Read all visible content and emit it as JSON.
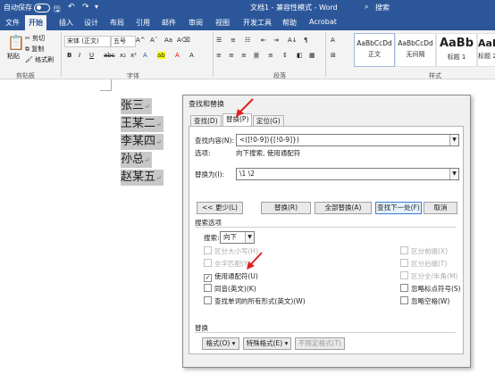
{
  "titlebar": {
    "autosave": "自动保存",
    "doc_title": "文档1 - 兼容性模式 - Word",
    "search": "搜索"
  },
  "menu": {
    "tabs": [
      "文件",
      "开始",
      "插入",
      "设计",
      "布局",
      "引用",
      "邮件",
      "审阅",
      "视图",
      "开发工具",
      "帮助",
      "Acrobat"
    ],
    "active": "开始"
  },
  "ribbon": {
    "clipboard": {
      "paste": "粘贴",
      "cut": "剪切",
      "copy": "复制",
      "format_painter": "格式刷",
      "label": "剪贴板"
    },
    "font": {
      "name": "宋体 (正文)",
      "size": "五号",
      "label": "字体"
    },
    "paragraph": {
      "label": "段落"
    },
    "styles": {
      "label": "样式",
      "cards": [
        {
          "sample": "AaBbCcDd",
          "name": "正文"
        },
        {
          "sample": "AaBbCcDd",
          "name": "无间隔"
        },
        {
          "sample": "AaBb",
          "name": "标题 1"
        },
        {
          "sample": "AaBbC",
          "name": "标题 2"
        }
      ]
    }
  },
  "document": {
    "lines": [
      "张三",
      "王某二",
      "李某四",
      "孙总",
      "赵某五"
    ]
  },
  "dialog": {
    "title": "查找和替换",
    "tabs": [
      "查找(D)",
      "替换(P)",
      "定位(G)"
    ],
    "find_label": "查找内容(N):",
    "find_value": "<([!0-9]){[!0-9]})",
    "options_label": "选项:",
    "options_value": "向下搜索, 使用通配符",
    "replace_label": "替换为(I):",
    "replace_value": "\\1   \\2",
    "buttons": {
      "less": "<< 更少(L)",
      "replace": "替换(R)",
      "replace_all": "全部替换(A)",
      "find_next": "查找下一处(F)",
      "cancel": "取消"
    },
    "search_options_title": "搜索选项",
    "search_label": "搜索:",
    "search_value": "向下",
    "checks_left": [
      {
        "label": "区分大小写(H)",
        "checked": false,
        "disabled": true
      },
      {
        "label": "全字匹配(Y)",
        "checked": false,
        "disabled": true
      },
      {
        "label": "使用通配符(U)",
        "checked": true,
        "disabled": false
      },
      {
        "label": "同音(英文)(K)",
        "checked": false,
        "disabled": false
      },
      {
        "label": "查找单词的所有形式(英文)(W)",
        "checked": false,
        "disabled": false
      }
    ],
    "checks_right": [
      {
        "label": "区分前缀(X)",
        "checked": false,
        "disabled": true
      },
      {
        "label": "区分后缀(T)",
        "checked": false,
        "disabled": true
      },
      {
        "label": "区分全/半角(M)",
        "checked": false,
        "disabled": true
      },
      {
        "label": "忽略标点符号(S)",
        "checked": false,
        "disabled": false
      },
      {
        "label": "忽略空格(W)",
        "checked": false,
        "disabled": false
      }
    ],
    "replace_section": "替换",
    "bottom_buttons": {
      "format": "格式(O) ▾",
      "special": "特殊格式(E) ▾",
      "no_format": "不限定格式(T)"
    }
  },
  "colors": {
    "brand": "#2b579a",
    "annotation": "#e02020"
  }
}
